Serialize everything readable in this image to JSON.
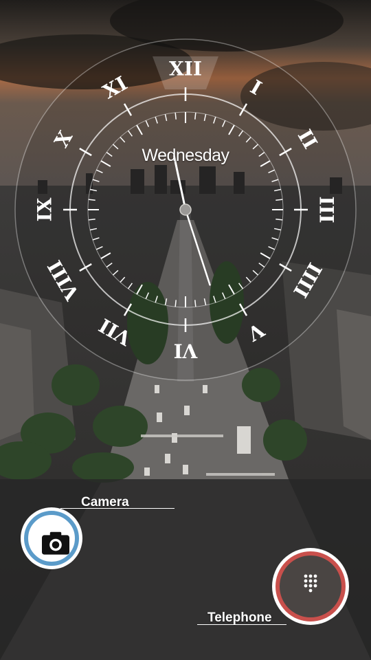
{
  "wallpaper": {
    "description_colors": {
      "sky_dark": "#2a2724",
      "sky_glow": "#b07048",
      "city": "#3b3a38",
      "trees": "#2f4a2a",
      "avenue": "#6a6866"
    }
  },
  "clock": {
    "day": "Wednesday",
    "numerals": [
      "XII",
      "I",
      "II",
      "III",
      "IIII",
      "V",
      "VI",
      "VII",
      "VIII",
      "IX",
      "X",
      "XI"
    ],
    "hour_hand_value": 11.6,
    "minute_hand_value": 27,
    "colors": {
      "ring": "#ffffff",
      "highlight": "rgba(255,255,255,0.18)"
    }
  },
  "shortcuts": {
    "camera": {
      "label": "Camera",
      "icon": "camera-icon",
      "ring_color": "#5b9bc9"
    },
    "phone": {
      "label": "Telephone",
      "icon": "dialpad-icon",
      "ring_color": "#c9504c"
    }
  }
}
